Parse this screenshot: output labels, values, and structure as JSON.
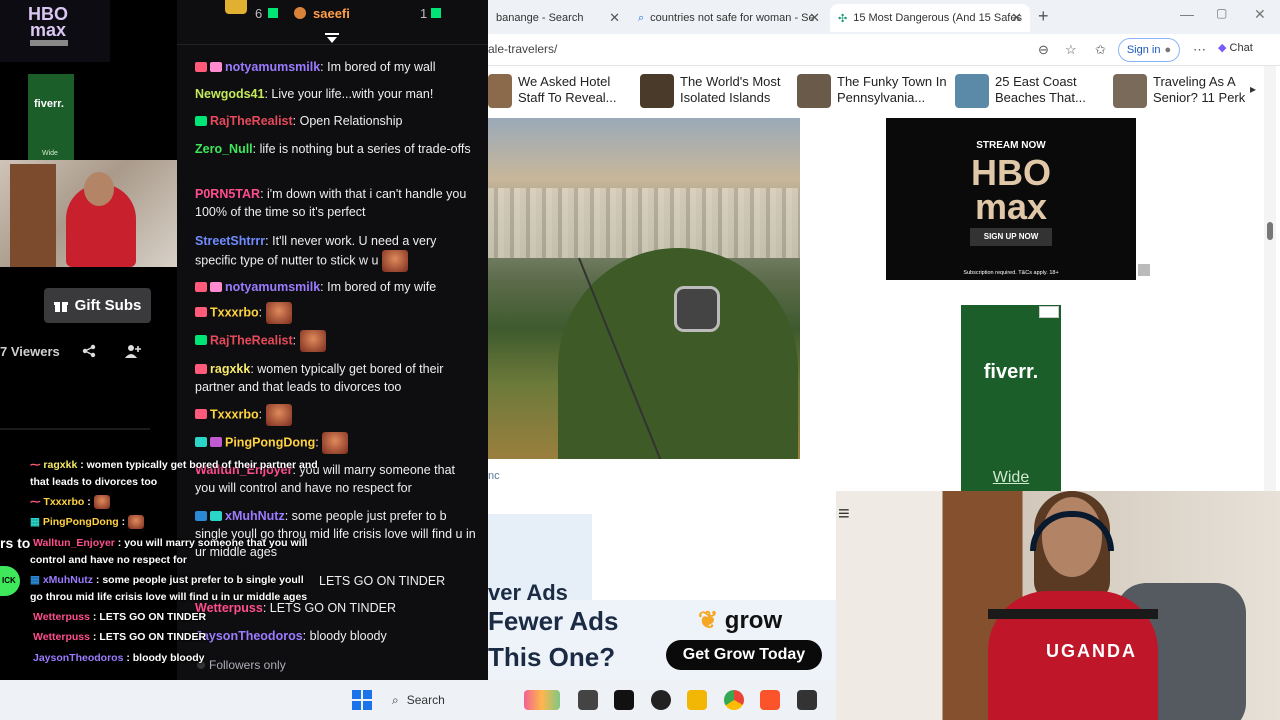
{
  "left_panel": {
    "hbo_small": {
      "logo_line1": "HBO",
      "logo_line2": "max"
    },
    "fiverr_small": {
      "brand": "fiverr.",
      "footer": "Wide"
    },
    "gift_subs_label": "Gift Subs",
    "viewers_label": "7 Viewers"
  },
  "chat": {
    "top": {
      "count_a": "6",
      "user": "saeefi",
      "count_b": "1"
    },
    "messages": [
      {
        "user": "notyamumsmilk",
        "text": ": Im bored of my wall",
        "color": "#9b7bff"
      },
      {
        "user": "Newgods41",
        "text": ": Live your life...with your man!",
        "color": "#c3e85a"
      },
      {
        "user": "RajTheRealist",
        "text": ": Open Relationship",
        "color": "#e64a5a"
      },
      {
        "user": "Zero_Null",
        "text": ": life is nothing but a series of trade-offs",
        "color": "#3ee85a"
      },
      {
        "user": "P0RN5TAR",
        "text": ": i'm down with that i can't handle you 100% of the time so it's perfect",
        "color": "#ff4d8d"
      },
      {
        "user": "StreetShtrrr",
        "text": ": It'll never work. U need a very specific type of nutter to stick w u",
        "color": "#6f8cff"
      },
      {
        "user": "notyamumsmilk",
        "text": ": Im bored of my wife",
        "color": "#9b7bff"
      },
      {
        "user": "Txxxrbo",
        "text": ":",
        "color": "#ffd23f"
      },
      {
        "user": "RajTheRealist",
        "text": ":",
        "color": "#e64a5a"
      },
      {
        "user": "ragxkk",
        "text": ": women typically get bored of their partner and that leads to divorces too",
        "color": "#f6e96b"
      },
      {
        "user": "Txxxrbo",
        "text": ":",
        "color": "#ffd23f"
      },
      {
        "user": "PingPongDong",
        "text": ":",
        "color": "#ffd23f"
      },
      {
        "user": "Walltun_Enjoyer",
        "text": ": you will marry someone that you will control and have no respect for",
        "color": "#ff4d8d"
      },
      {
        "user": "xMuhNutz",
        "text": ": some people just prefer to b single youll go throu mid life crisis love will find u in ur middle ages",
        "color": "#9b7bff"
      },
      {
        "user": "",
        "text": "LETS GO ON TINDER",
        "color": "#efeff1"
      },
      {
        "user": "Wetterpuss",
        "text": ": LETS GO ON TINDER",
        "color": "#ff4d8d"
      },
      {
        "user": "JaysonTheodoros",
        "text": ": bloody bloody",
        "color": "#9b7bff"
      }
    ],
    "followers_only": "Followers only"
  },
  "overlay": [
    {
      "user": "ragxkk",
      "text": " : women typically get bored of their partner and",
      "color": "#f6e96b"
    },
    {
      "user": "",
      "text": "that leads to divorces too",
      "color": "#ffffff"
    },
    {
      "user": "Txxxrbo",
      "text": " :",
      "color": "#ffd23f"
    },
    {
      "user": "PingPongDong",
      "text": " :",
      "color": "#ffd23f"
    },
    {
      "user": "Walltun_Enjoyer",
      "text": " : you will marry someone that you will",
      "color": "#ff4d8d"
    },
    {
      "user": "",
      "text": "control and have no respect for",
      "color": "#ffffff"
    },
    {
      "user": "xMuhNutz",
      "text": " : some people just prefer to b single youll",
      "color": "#9b7bff"
    },
    {
      "user": "",
      "text": "go throu mid life crisis love will find u in ur middle ages",
      "color": "#ffffff"
    },
    {
      "user": "Wetterpuss",
      "text": " : LETS GO ON TINDER",
      "color": "#ff4d8d"
    },
    {
      "user": "Wetterpuss",
      "text": " : LETS GO ON TINDER",
      "color": "#ff4d8d"
    },
    {
      "user": "JaysonTheodoros",
      "text": " : bloody bloody",
      "color": "#9b7bff"
    }
  ],
  "overlay_partial": {
    "left_text": "rs to",
    "badge": "ICK"
  },
  "browser": {
    "tabs": [
      {
        "title": "banange - Search"
      },
      {
        "title": "countries not safe for woman - Se"
      },
      {
        "title": "15 Most Dangerous (And 15 Safes"
      }
    ],
    "url": "ale-travelers/",
    "signin": "Sign in",
    "chat": "Chat",
    "articles": [
      {
        "title": "We Asked Hotel Staff To Reveal...",
        "thumb": "#8a6a4a"
      },
      {
        "title": "The World's Most Isolated Islands",
        "thumb": "#4a3a2a"
      },
      {
        "title": "The Funky Town In Pennsylvania...",
        "thumb": "#6a5a4a"
      },
      {
        "title": "25 East Coast Beaches That...",
        "thumb": "#5a8aa8"
      },
      {
        "title": "Traveling As A Senior? 11 Perk",
        "thumb": "#7a6a5a"
      }
    ],
    "hbo_ad": {
      "stream": "STREAM NOW",
      "logo1": "HBO",
      "logo2": "max",
      "button": "SIGN UP NOW",
      "fine": "Subscription required. T&Cs apply. 18+"
    },
    "fiverr_ad": {
      "brand": "fiverr.",
      "footer": "Wide"
    },
    "c_letter": "nc",
    "banner": {
      "line1": "ver Ads",
      "line2": "Fewer Ads",
      "line3": "This One?",
      "grow": "grow",
      "cta": "Get Grow Today"
    }
  },
  "camera": {
    "jersey": "UGANDA"
  },
  "taskbar": {
    "search": "Search"
  }
}
